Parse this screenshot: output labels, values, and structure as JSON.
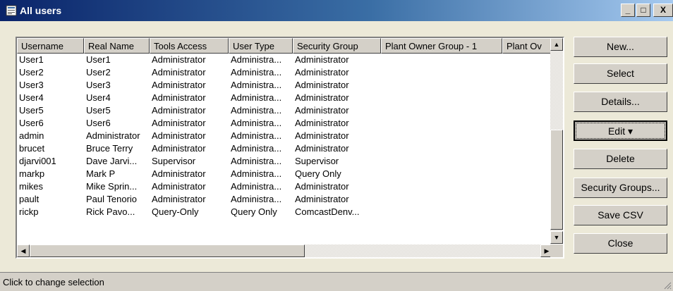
{
  "window": {
    "title": "All users",
    "icon": "users-window-icon"
  },
  "caption_buttons": {
    "minimize": "_",
    "maximize": "□",
    "close": "X"
  },
  "columns": [
    "Username",
    "Real Name",
    "Tools Access",
    "User Type",
    "Security Group",
    "Plant Owner Group - 1",
    "Plant Ov"
  ],
  "rows": [
    [
      "User1",
      "User1",
      "Administrator",
      "Administra...",
      "Administrator",
      "",
      ""
    ],
    [
      "User2",
      "User2",
      "Administrator",
      "Administra...",
      "Administrator",
      "",
      ""
    ],
    [
      "User3",
      "User3",
      "Administrator",
      "Administra...",
      "Administrator",
      "",
      ""
    ],
    [
      "User4",
      "User4",
      "Administrator",
      "Administra...",
      "Administrator",
      "",
      ""
    ],
    [
      "User5",
      "User5",
      "Administrator",
      "Administra...",
      "Administrator",
      "",
      ""
    ],
    [
      "User6",
      "User6",
      "Administrator",
      "Administra...",
      "Administrator",
      "",
      ""
    ],
    [
      "admin",
      "Administrator",
      "Administrator",
      "Administra...",
      "Administrator",
      "",
      ""
    ],
    [
      "brucet",
      "Bruce Terry",
      "Administrator",
      "Administra...",
      "Administrator",
      "",
      ""
    ],
    [
      "djarvi001",
      "Dave Jarvi...",
      "Supervisor",
      "Administra...",
      "Supervisor",
      "",
      ""
    ],
    [
      "markp",
      "Mark P",
      "Administrator",
      "Administra...",
      "Query Only",
      "",
      ""
    ],
    [
      "mikes",
      "Mike Sprin...",
      "Administrator",
      "Administra...",
      "Administrator",
      "",
      ""
    ],
    [
      "pault",
      "Paul Tenorio",
      "Administrator",
      "Administra...",
      "Administrator",
      "",
      ""
    ],
    [
      "rickp",
      "Rick Pavo...",
      "Query-Only",
      "Query Only",
      "ComcastDenv...",
      "",
      ""
    ]
  ],
  "buttons": {
    "new": "New...",
    "select": "Select",
    "details": "Details...",
    "edit": "Edit ▾",
    "delete": "Delete",
    "security_groups": "Security Groups...",
    "save_csv": "Save CSV",
    "close": "Close"
  },
  "scroll": {
    "up": "▲",
    "down": "▼",
    "left": "◀",
    "right": "▶"
  },
  "status": {
    "text": "Click to change selection"
  }
}
